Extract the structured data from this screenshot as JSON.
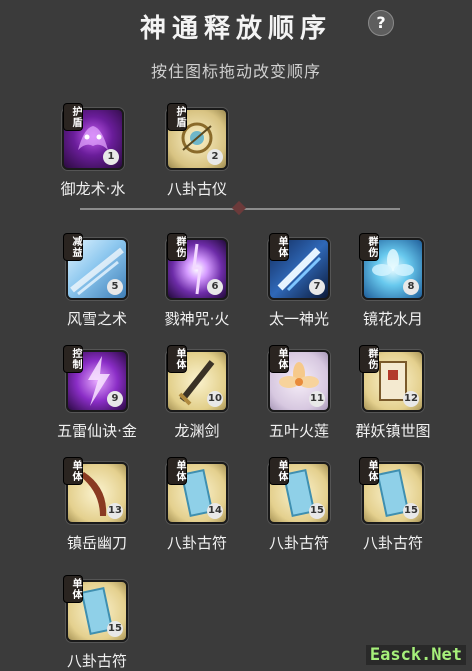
{
  "header": {
    "title": "神通释放顺序",
    "help_label": "?",
    "subtitle": "按住图标拖动改变顺序"
  },
  "colors": {
    "background": "#3b3b3b",
    "tag_bg": "#2a2420"
  },
  "skills": [
    {
      "tag": "护盾",
      "name": "御龙术·水",
      "num": "1",
      "icon": "purple-dragon-icon"
    },
    {
      "tag": "护盾",
      "name": "八卦古仪",
      "num": "2",
      "icon": "bagua-instrument-icon"
    },
    {
      "tag": "减益",
      "name": "风雪之术",
      "num": "5",
      "icon": "blizzard-icon"
    },
    {
      "tag": "群伤",
      "name": "戮神咒·火",
      "num": "6",
      "icon": "purple-curse-icon"
    },
    {
      "tag": "单体",
      "name": "太一神光",
      "num": "7",
      "icon": "divine-light-icon"
    },
    {
      "tag": "群伤",
      "name": "镜花水月",
      "num": "8",
      "icon": "water-flower-icon"
    },
    {
      "tag": "控制",
      "name": "五雷仙诀·金",
      "num": "9",
      "icon": "thunder-icon"
    },
    {
      "tag": "单体",
      "name": "龙渊剑",
      "num": "10",
      "icon": "sword-icon"
    },
    {
      "tag": "单体",
      "name": "五叶火莲",
      "num": "11",
      "icon": "lotus-icon"
    },
    {
      "tag": "群伤",
      "name": "群妖镇世图",
      "num": "12",
      "icon": "scroll-icon"
    },
    {
      "tag": "单体",
      "name": "镇岳幽刀",
      "num": "13",
      "icon": "blade-icon"
    },
    {
      "tag": "单体",
      "name": "八卦古符",
      "num": "14",
      "icon": "talisman-icon"
    },
    {
      "tag": "单体",
      "name": "八卦古符",
      "num": "15",
      "icon": "talisman-icon"
    },
    {
      "tag": "单体",
      "name": "八卦古符",
      "num": "15",
      "icon": "talisman-icon"
    },
    {
      "tag": "单体",
      "name": "八卦古符",
      "num": "15",
      "icon": "talisman-icon"
    }
  ],
  "watermark": "Easck.Net"
}
